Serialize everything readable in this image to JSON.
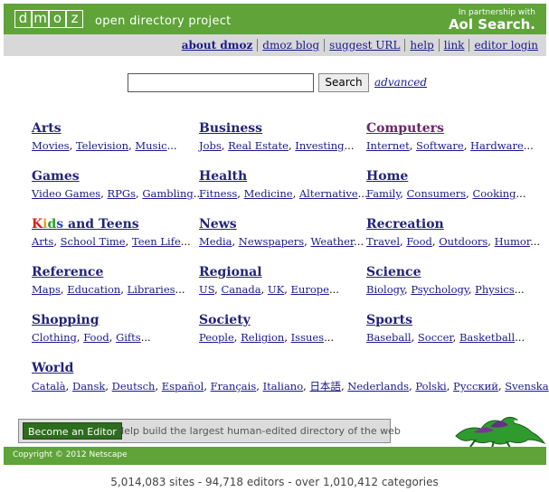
{
  "header": {
    "logo_letters": [
      "d",
      "m",
      "o",
      "z"
    ],
    "tagline": "open directory project",
    "partner_line": "In partnership with",
    "partner_brand": "Aol Search."
  },
  "nav": {
    "items": [
      {
        "label": "about dmoz",
        "bold": true
      },
      {
        "label": "dmoz blog"
      },
      {
        "label": "suggest URL"
      },
      {
        "label": "help"
      },
      {
        "label": "link"
      },
      {
        "label": "editor login"
      }
    ]
  },
  "search": {
    "value": "",
    "button_label": "Search",
    "advanced_label": "advanced"
  },
  "categories": [
    {
      "title": "Arts",
      "subs": [
        "Movies",
        "Television",
        "Music"
      ]
    },
    {
      "title": "Business",
      "subs": [
        "Jobs",
        "Real Estate",
        "Investing"
      ]
    },
    {
      "title": "Computers",
      "subs": [
        "Internet",
        "Software",
        "Hardware"
      ]
    },
    {
      "title": "Games",
      "subs": [
        "Video Games",
        "RPGs",
        "Gambling"
      ]
    },
    {
      "title": "Health",
      "subs": [
        "Fitness",
        "Medicine",
        "Alternative"
      ]
    },
    {
      "title": "Home",
      "subs": [
        "Family",
        "Consumers",
        "Cooking"
      ]
    },
    {
      "title": "Kids and Teens",
      "title_rest": "and Teens",
      "subs": [
        "Arts",
        "School Time",
        "Teen Life"
      ]
    },
    {
      "title": "News",
      "subs": [
        "Media",
        "Newspapers",
        "Weather"
      ]
    },
    {
      "title": "Recreation",
      "subs": [
        "Travel",
        "Food",
        "Outdoors",
        "Humor"
      ]
    },
    {
      "title": "Reference",
      "subs": [
        "Maps",
        "Education",
        "Libraries"
      ]
    },
    {
      "title": "Regional",
      "subs": [
        "US",
        "Canada",
        "UK",
        "Europe"
      ]
    },
    {
      "title": "Science",
      "subs": [
        "Biology",
        "Psychology",
        "Physics"
      ]
    },
    {
      "title": "Shopping",
      "subs": [
        "Clothing",
        "Food",
        "Gifts"
      ]
    },
    {
      "title": "Society",
      "subs": [
        "People",
        "Religion",
        "Issues"
      ]
    },
    {
      "title": "Sports",
      "subs": [
        "Baseball",
        "Soccer",
        "Basketball"
      ]
    },
    {
      "title": "World",
      "subs": [
        "Català",
        "Dansk",
        "Deutsch",
        "Español",
        "Français",
        "Italiano",
        "日本語",
        "Nederlands",
        "Polski",
        "Русский",
        "Svenska"
      ]
    }
  ],
  "editor": {
    "button_label": "Become an Editor",
    "text": "Help build the largest human-edited directory of the web"
  },
  "footer": {
    "copyright": "Copyright © 2012 Netscape",
    "stats": "5,014,083 sites - 94,718 editors - over 1,010,412 categories"
  },
  "colors": {
    "header_green": "#5fa339",
    "nav_gray": "#d8d8d8",
    "link_blue": "#1a1a8c",
    "visited_purple": "#6b246e"
  }
}
